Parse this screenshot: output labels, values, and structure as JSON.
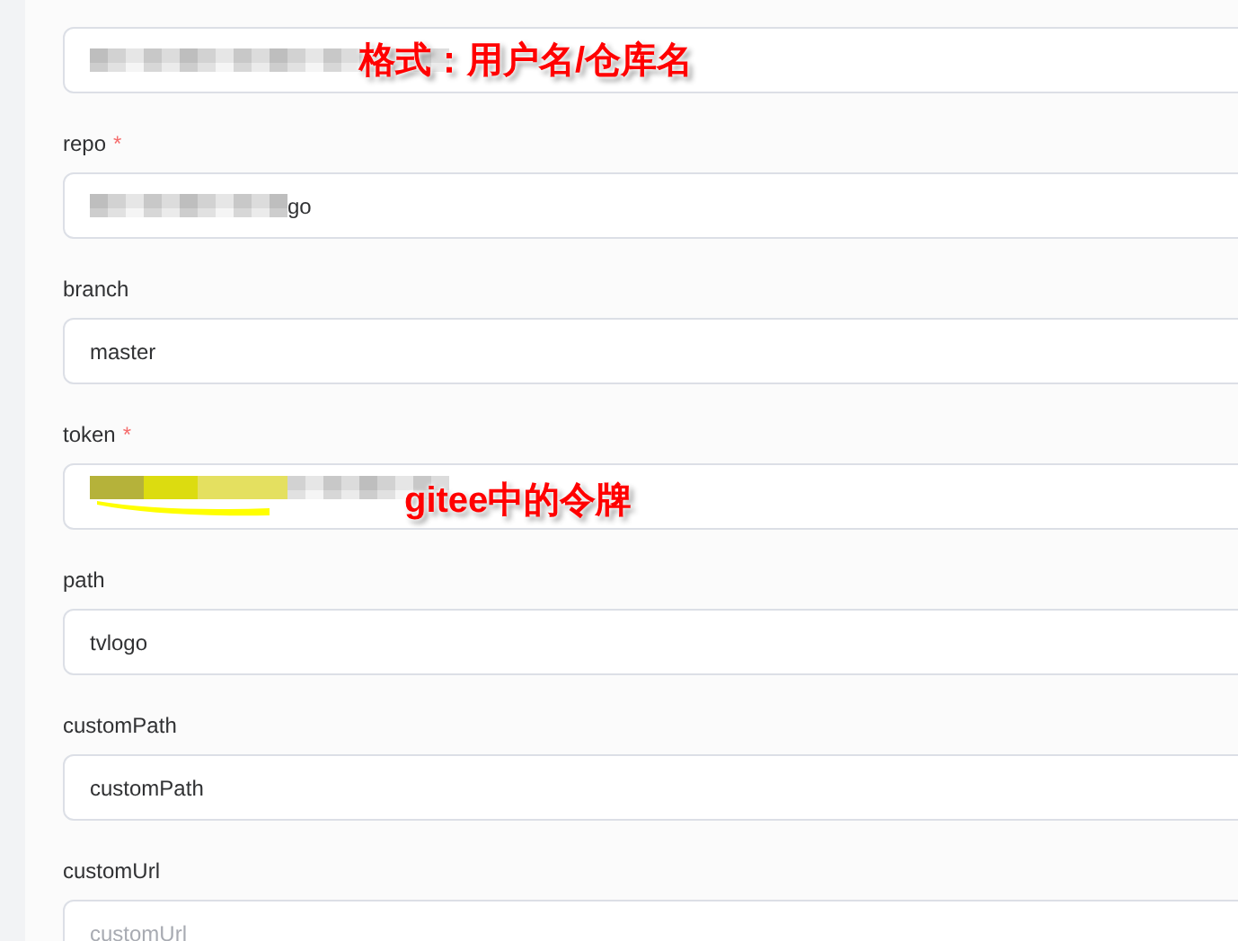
{
  "fields": [
    {
      "redacted": true,
      "highlighted": false,
      "annotation": "格式：用户名/仓库名"
    },
    {
      "label": "repo",
      "required_mark": "*",
      "redacted": true,
      "highlighted": false,
      "value": "go"
    },
    {
      "label": "branch",
      "value": "master",
      "redacted": false,
      "highlighted": false
    },
    {
      "label": "token",
      "required_mark": "*",
      "redacted": true,
      "highlighted": true,
      "annotation": "gitee中的令牌"
    },
    {
      "label": "path",
      "value": "tvlogo",
      "redacted": false,
      "highlighted": false
    },
    {
      "label": "customPath",
      "value": "customPath",
      "redacted": false,
      "highlighted": false
    },
    {
      "label": "customUrl",
      "placeholder": "customUrl",
      "redacted": false,
      "highlighted": false
    }
  ]
}
